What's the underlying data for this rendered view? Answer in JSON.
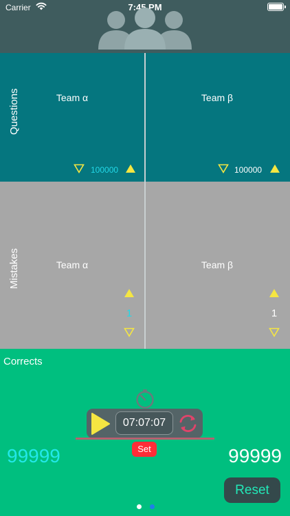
{
  "status_bar": {
    "carrier": "Carrier",
    "time": "7:45 PM"
  },
  "header": {
    "icon": "group-icon"
  },
  "questions": {
    "label": "Questions",
    "teams": [
      {
        "name": "Team α",
        "count": "100000",
        "count_color": "#22d8e8"
      },
      {
        "name": "Team β",
        "count": "100000",
        "count_color": "#ffffff"
      }
    ]
  },
  "mistakes": {
    "label": "Mistakes",
    "teams": [
      {
        "name": "Team α",
        "value": "1",
        "value_color": "#22d8e8"
      },
      {
        "name": "Team β",
        "value": "1",
        "value_color": "#ffffff"
      }
    ]
  },
  "corrects": {
    "label": "Corrects",
    "timer": "07:07:07",
    "set_label": "Set",
    "score_left": "99999",
    "score_right": "99999",
    "reset_label": "Reset"
  },
  "page_indicator": {
    "count": 2,
    "active": 1
  },
  "colors": {
    "header": "#3f5c5e",
    "questions_bg": "#05767f",
    "mistakes_bg": "#a7a7a7",
    "corrects_bg": "#00bf7f",
    "triangle": "#f5e642",
    "set_button": "#ff2d37",
    "reset_text": "#22e8b8"
  }
}
